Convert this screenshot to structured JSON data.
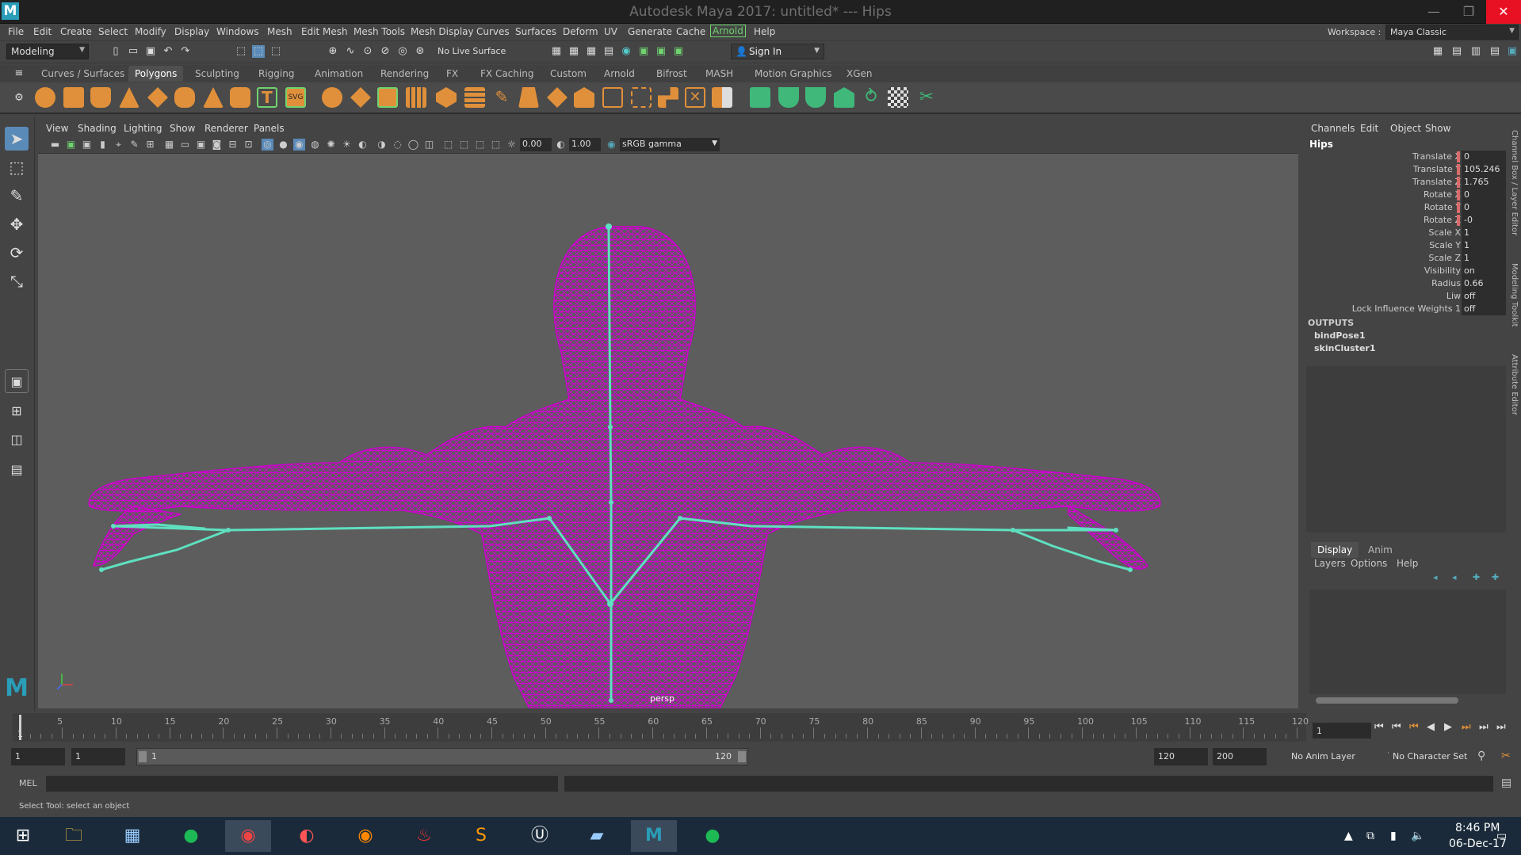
{
  "window": {
    "title": "Autodesk Maya 2017: untitled*   ---   Hips",
    "logo": "M",
    "min": "—",
    "max": "❐",
    "close": "✕"
  },
  "menubar": {
    "items": [
      "File",
      "Edit",
      "Create",
      "Select",
      "Modify",
      "Display",
      "Windows",
      "Mesh",
      "Edit Mesh",
      "Mesh Tools",
      "Mesh Display",
      "Curves",
      "Surfaces",
      "Deform",
      "UV",
      "Generate",
      "Cache",
      "Arnold",
      "Help"
    ],
    "workspace_label": "Workspace :",
    "workspace_value": "Maya Classic"
  },
  "statusline": {
    "mode": "Modeling",
    "live_surface": "No Live Surface",
    "sign_in": "Sign In"
  },
  "shelf": {
    "tabs": [
      "Curves / Surfaces",
      "Polygons",
      "Sculpting",
      "Rigging",
      "Animation",
      "Rendering",
      "FX",
      "FX Caching",
      "Custom",
      "Arnold",
      "Bifrost",
      "MASH",
      "Motion Graphics",
      "XGen"
    ],
    "active_tab": "Polygons"
  },
  "panel": {
    "menus": [
      "View",
      "Shading",
      "Lighting",
      "Show",
      "Renderer",
      "Panels"
    ],
    "exposure": "0.00",
    "gamma": "1.00",
    "color_space": "sRGB gamma",
    "camera_label": "persp"
  },
  "channels": {
    "menus": [
      "Channels",
      "Edit",
      "Object",
      "Show"
    ],
    "object": "Hips",
    "attributes": [
      {
        "label": "Translate X",
        "value": "0"
      },
      {
        "label": "Translate Y",
        "value": "105.246"
      },
      {
        "label": "Translate Z",
        "value": "1.765"
      },
      {
        "label": "Rotate X",
        "value": "0"
      },
      {
        "label": "Rotate Y",
        "value": "0"
      },
      {
        "label": "Rotate Z",
        "value": "-0"
      },
      {
        "label": "Scale X",
        "value": "1"
      },
      {
        "label": "Scale Y",
        "value": "1"
      },
      {
        "label": "Scale Z",
        "value": "1"
      },
      {
        "label": "Visibility",
        "value": "on"
      },
      {
        "label": "Radius",
        "value": "0.66"
      },
      {
        "label": "Liw",
        "value": "off"
      },
      {
        "label": "Lock Influence Weights 1",
        "value": "off"
      }
    ],
    "outputs_label": "OUTPUTS",
    "outputs": [
      "bindPose1",
      "skinCluster1"
    ]
  },
  "layer_editor": {
    "tabs": [
      "Display",
      "Anim"
    ],
    "menus": [
      "Layers",
      "Options",
      "Help"
    ]
  },
  "side_tabs": [
    "Channel Box / Layer Editor",
    "Modeling Toolkit",
    "Attribute Editor"
  ],
  "timeline": {
    "ticks": [
      "5",
      "10",
      "15",
      "20",
      "25",
      "30",
      "35",
      "40",
      "45",
      "50",
      "55",
      "60",
      "65",
      "70",
      "75",
      "80",
      "85",
      "90",
      "95",
      "100",
      "105",
      "110",
      "115",
      "120"
    ],
    "start_label": "1",
    "current_frame": "1"
  },
  "range": {
    "start": "1",
    "start2": "1",
    "slider_start": "1",
    "slider_end": "120",
    "end": "120",
    "end2": "200",
    "anim_layer": "No Anim Layer",
    "char_set": "No Character Set"
  },
  "command": {
    "label": "MEL",
    "help_text": "Select Tool: select an object"
  },
  "taskbar": {
    "time": "8:46 PM",
    "date": "06-Dec-17"
  },
  "colors": {
    "mesh": "#cc00cc",
    "joint": "#5fe0c0",
    "viewport_bg": "#5d5d5d"
  }
}
